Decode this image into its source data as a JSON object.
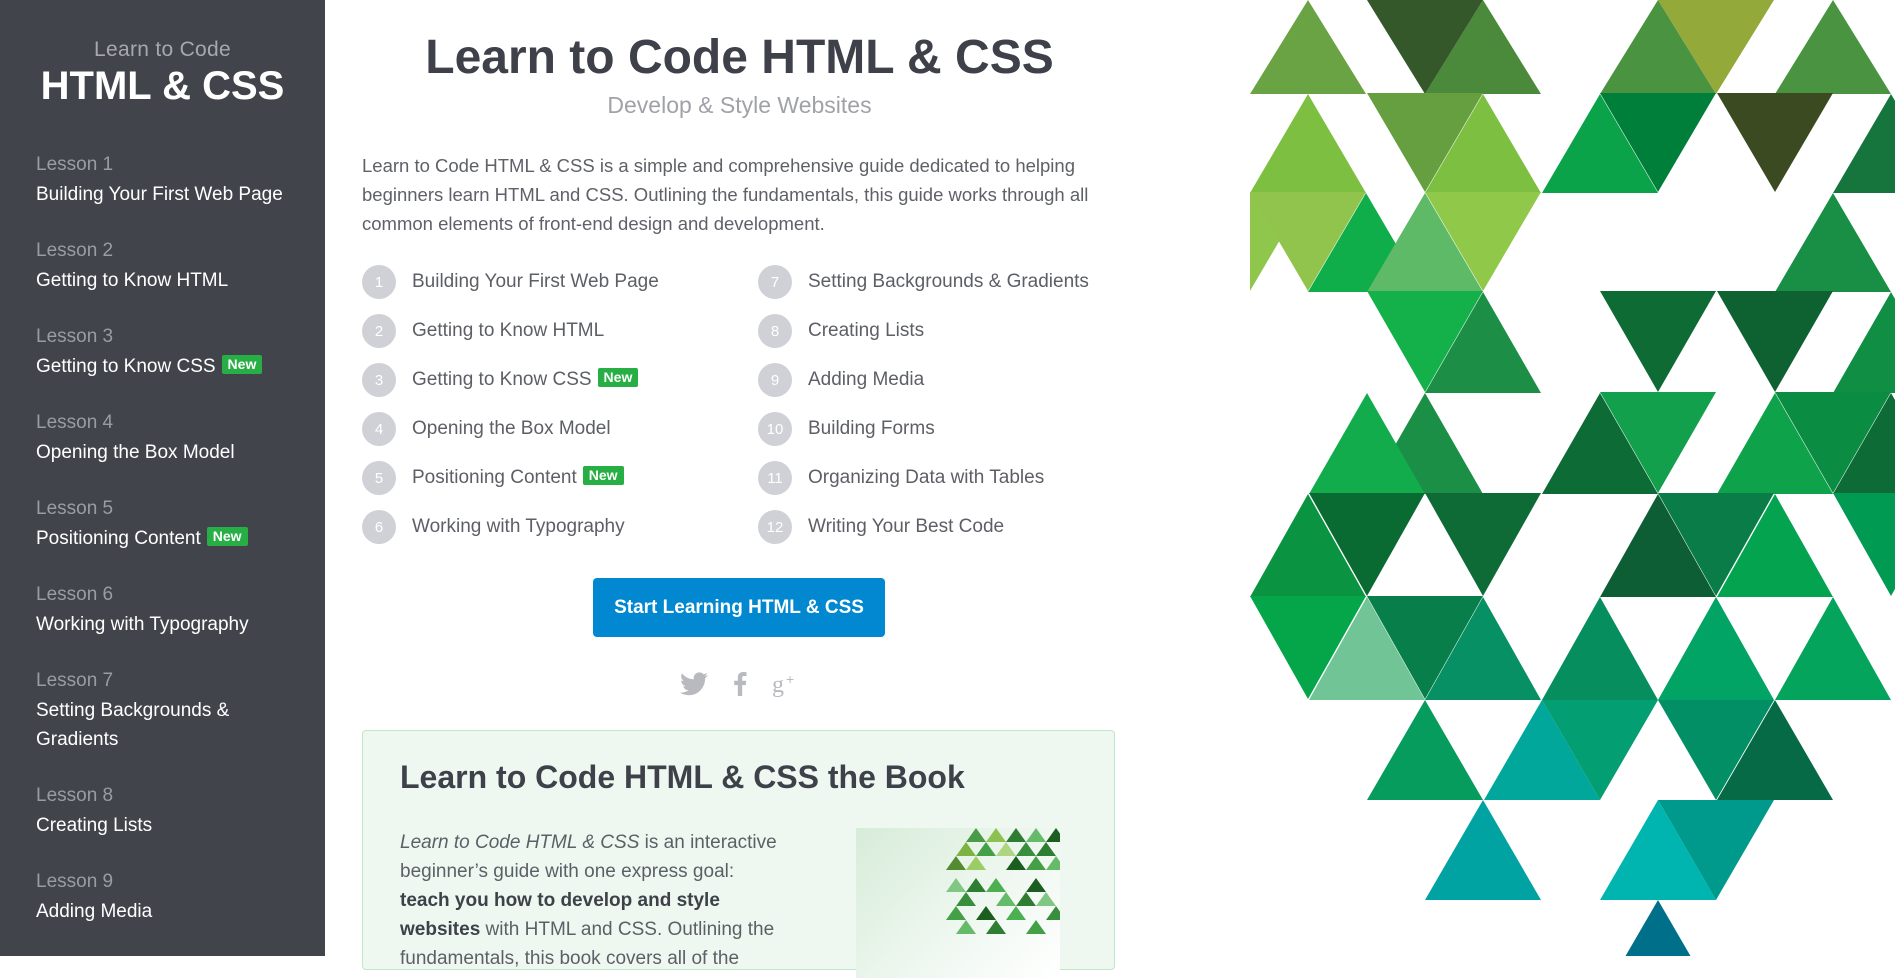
{
  "sidebar": {
    "brand_sub": "Learn to Code",
    "brand_title": "HTML & CSS",
    "badge_label": "New",
    "lessons": [
      {
        "num": "Lesson 1",
        "title": "Building Your First Web Page"
      },
      {
        "num": "Lesson 2",
        "title": "Getting to Know HTML"
      },
      {
        "num": "Lesson 3",
        "title": "Getting to Know CSS"
      },
      {
        "num": "Lesson 4",
        "title": "Opening the Box Model"
      },
      {
        "num": "Lesson 5",
        "title": "Positioning Content"
      },
      {
        "num": "Lesson 6",
        "title": "Working with Typography"
      },
      {
        "num": "Lesson 7",
        "title": "Setting Backgrounds & Gradients"
      },
      {
        "num": "Lesson 8",
        "title": "Creating Lists"
      },
      {
        "num": "Lesson 9",
        "title": "Adding Media"
      }
    ]
  },
  "main": {
    "title": "Learn to Code HTML & CSS",
    "subtitle": "Develop & Style Websites",
    "intro": "Learn to Code HTML & CSS is a simple and comprehensive guide dedicated to helping beginners learn HTML and CSS. Outlining the fundamentals, this guide works through all common elements of front-end design and development.",
    "lessons": [
      {
        "n": "1",
        "label": "Building Your First Web Page"
      },
      {
        "n": "2",
        "label": "Getting to Know HTML"
      },
      {
        "n": "3",
        "label": "Getting to Know CSS"
      },
      {
        "n": "4",
        "label": "Opening the Box Model"
      },
      {
        "n": "5",
        "label": "Positioning Content"
      },
      {
        "n": "6",
        "label": "Working with Typography"
      },
      {
        "n": "7",
        "label": "Setting Backgrounds & Gradients"
      },
      {
        "n": "8",
        "label": "Creating Lists"
      },
      {
        "n": "9",
        "label": "Adding Media"
      },
      {
        "n": "10",
        "label": "Building Forms"
      },
      {
        "n": "11",
        "label": "Organizing Data with Tables"
      },
      {
        "n": "12",
        "label": "Writing Your Best Code"
      }
    ],
    "cta_label": "Start Learning HTML & CSS",
    "social_icons": [
      "twitter-icon",
      "facebook-icon",
      "google-plus-icon"
    ]
  },
  "book": {
    "title": "Learn to Code HTML & CSS the Book",
    "text_italic": "Learn to Code HTML & CSS",
    "text_1": " is an interactive beginner’s guide with one express goal: ",
    "text_bold": "teach you how to develop and style websites",
    "text_2": " with HTML and CSS. Outlining the fundamentals, this book covers all of the"
  },
  "colors": {
    "sidebar_bg": "#42444c",
    "badge": "#27ae44",
    "cta": "#0288d1",
    "book_bg": "#eef8f0"
  }
}
